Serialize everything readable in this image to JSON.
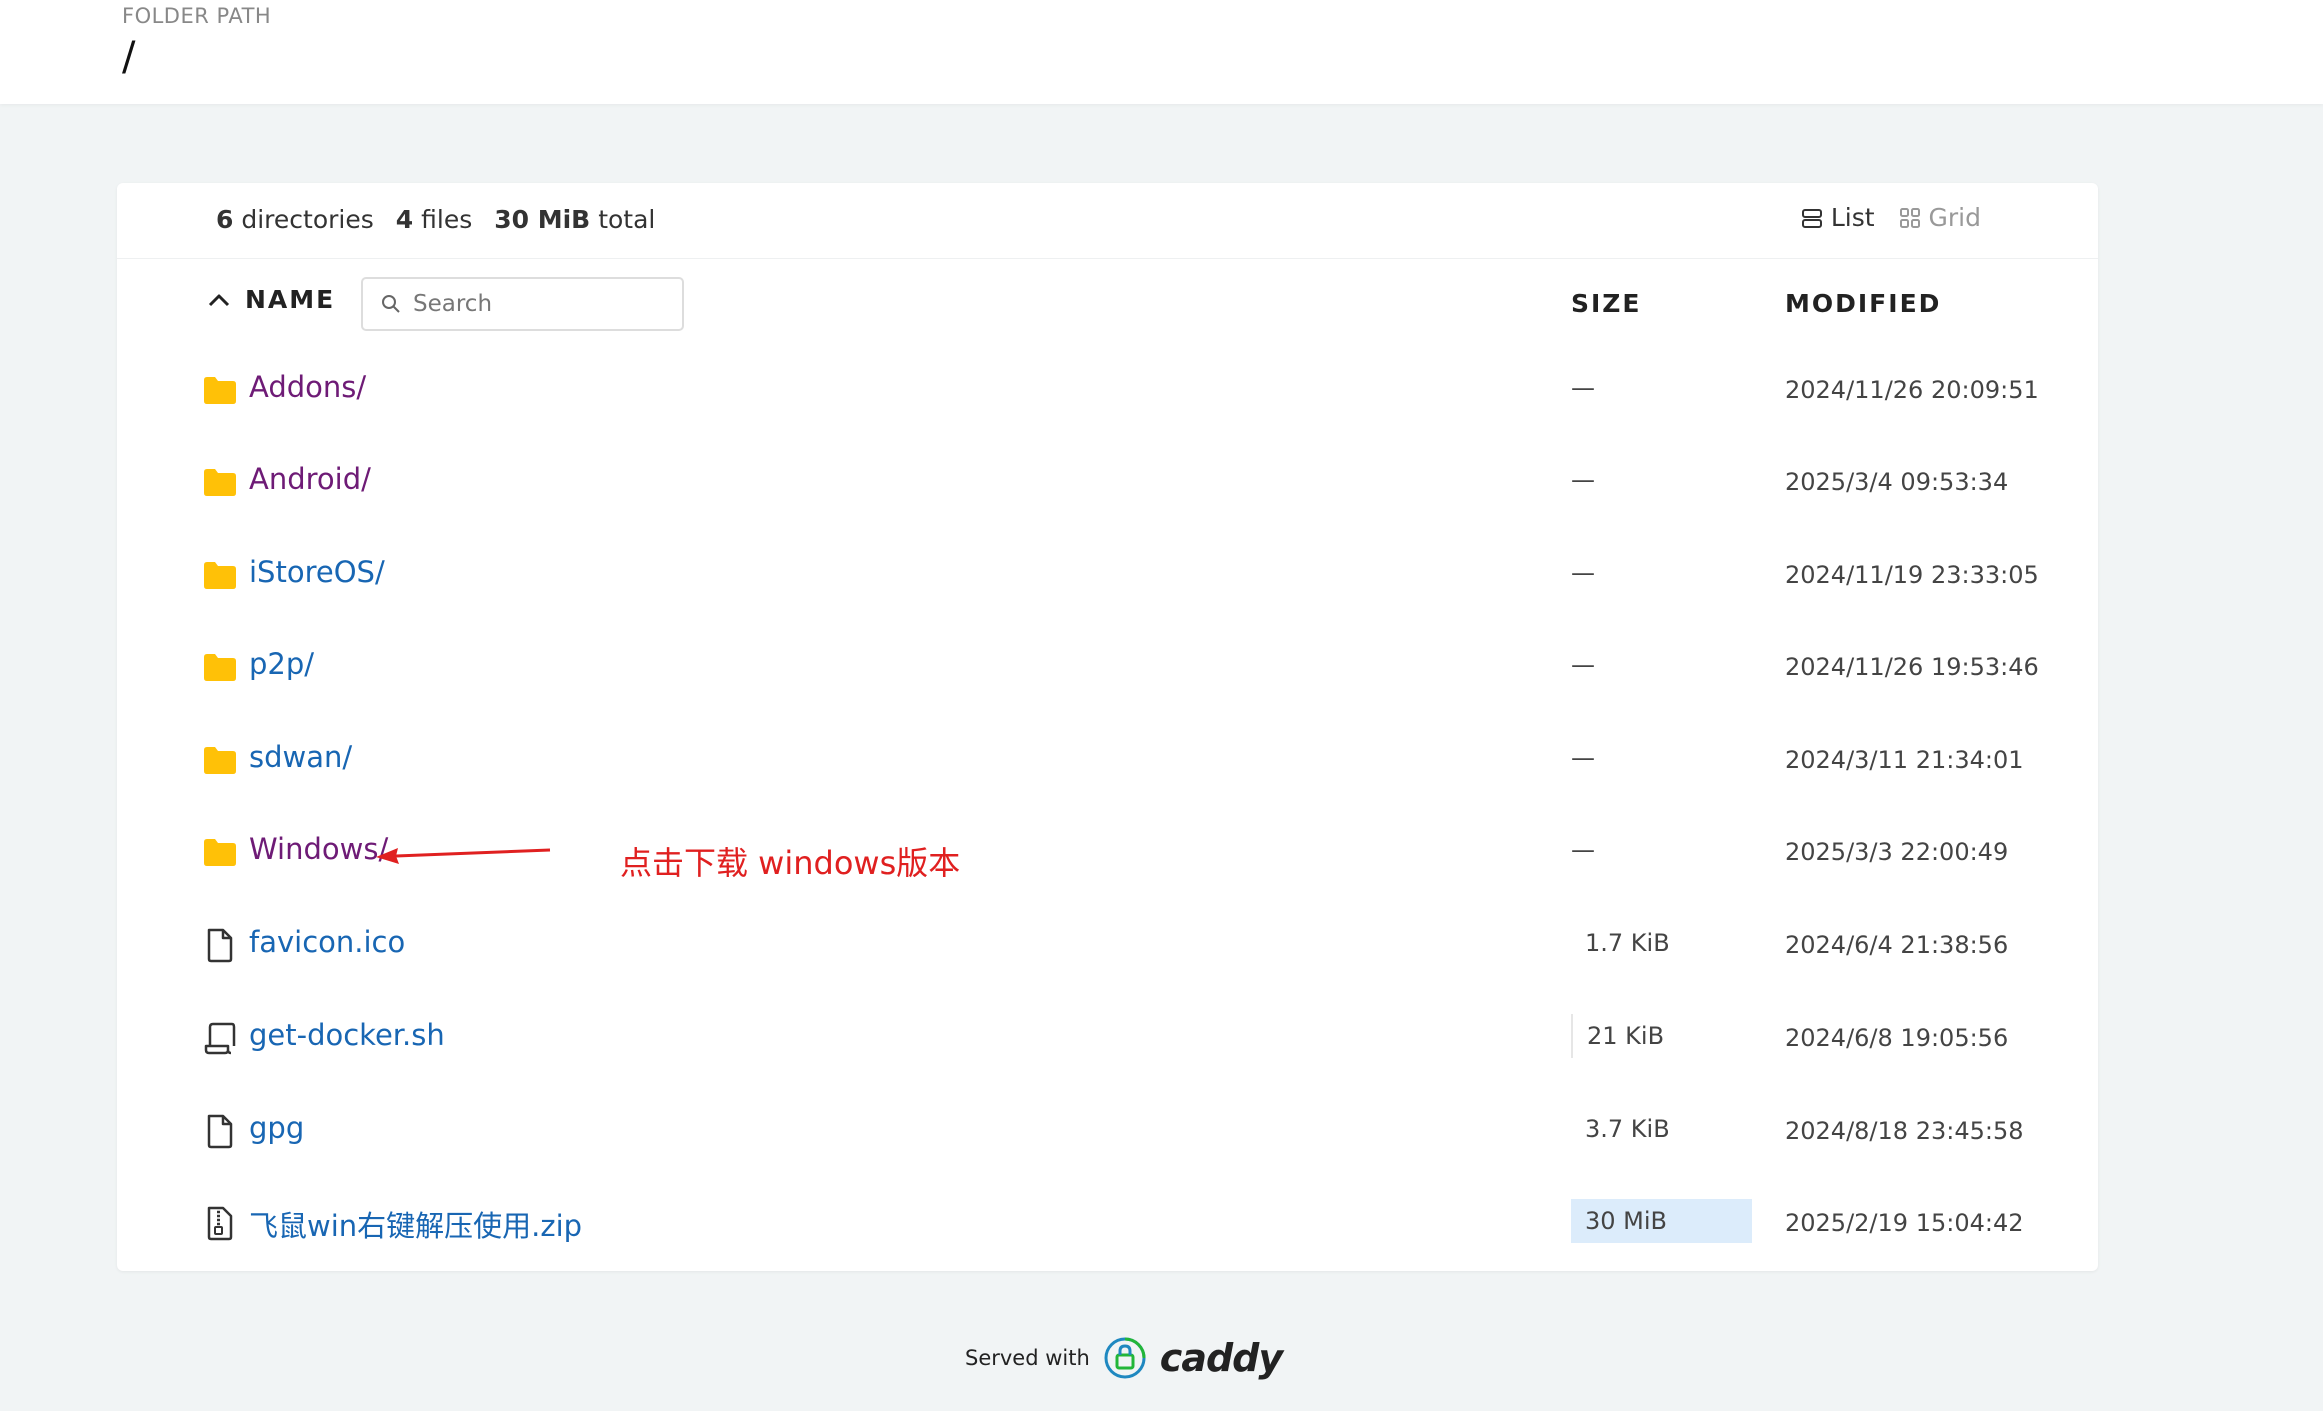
{
  "header": {
    "label": "FOLDER PATH",
    "path": "/"
  },
  "summary": {
    "directories_count": "6",
    "directories_label": "directories",
    "files_count": "4",
    "files_label": "files",
    "total_size": "30 MiB",
    "total_label": "total"
  },
  "view": {
    "list_label": "List",
    "grid_label": "Grid",
    "active": "list"
  },
  "columns": {
    "name": "NAME",
    "size": "SIZE",
    "modified": "MODIFIED"
  },
  "search": {
    "placeholder": "Search",
    "value": ""
  },
  "rows": [
    {
      "icon": "folder-icon",
      "name": "Addons/",
      "size": "—",
      "modified": "2024/11/26 20:09:51",
      "visited": true
    },
    {
      "icon": "folder-icon",
      "name": "Android/",
      "size": "—",
      "modified": "2025/3/4 09:53:34",
      "visited": true
    },
    {
      "icon": "folder-icon",
      "name": "iStoreOS/",
      "size": "—",
      "modified": "2024/11/19 23:33:05",
      "visited": false
    },
    {
      "icon": "folder-icon",
      "name": "p2p/",
      "size": "—",
      "modified": "2024/11/26 19:53:46",
      "visited": false
    },
    {
      "icon": "folder-icon",
      "name": "sdwan/",
      "size": "—",
      "modified": "2024/3/11 21:34:01",
      "visited": false
    },
    {
      "icon": "folder-icon",
      "name": "Windows/",
      "size": "—",
      "modified": "2025/3/3 22:00:49",
      "visited": true
    },
    {
      "icon": "file-icon",
      "name": "favicon.ico",
      "size": "1.7 KiB",
      "modified": "2024/6/4 21:38:56",
      "visited": false
    },
    {
      "icon": "script-icon",
      "name": "get-docker.sh",
      "size": "21 KiB",
      "modified": "2024/6/8 19:05:56",
      "visited": false
    },
    {
      "icon": "file-icon",
      "name": "gpg",
      "size": "3.7 KiB",
      "modified": "2024/8/18 23:45:58",
      "visited": false
    },
    {
      "icon": "zip-icon",
      "name": "飞鼠win右键解压使用.zip",
      "size": "30 MiB",
      "modified": "2025/2/19 15:04:42",
      "visited": false
    }
  ],
  "annotation": {
    "text": "点击下载 windows版本",
    "color": "#e02020"
  },
  "footer": {
    "served_with": "Served with",
    "brand": "caddy"
  },
  "colors": {
    "folder": "#ffc107",
    "visited_link": "#6e1b76",
    "link": "#1866b3",
    "size_highlight": "#dcecfb"
  }
}
